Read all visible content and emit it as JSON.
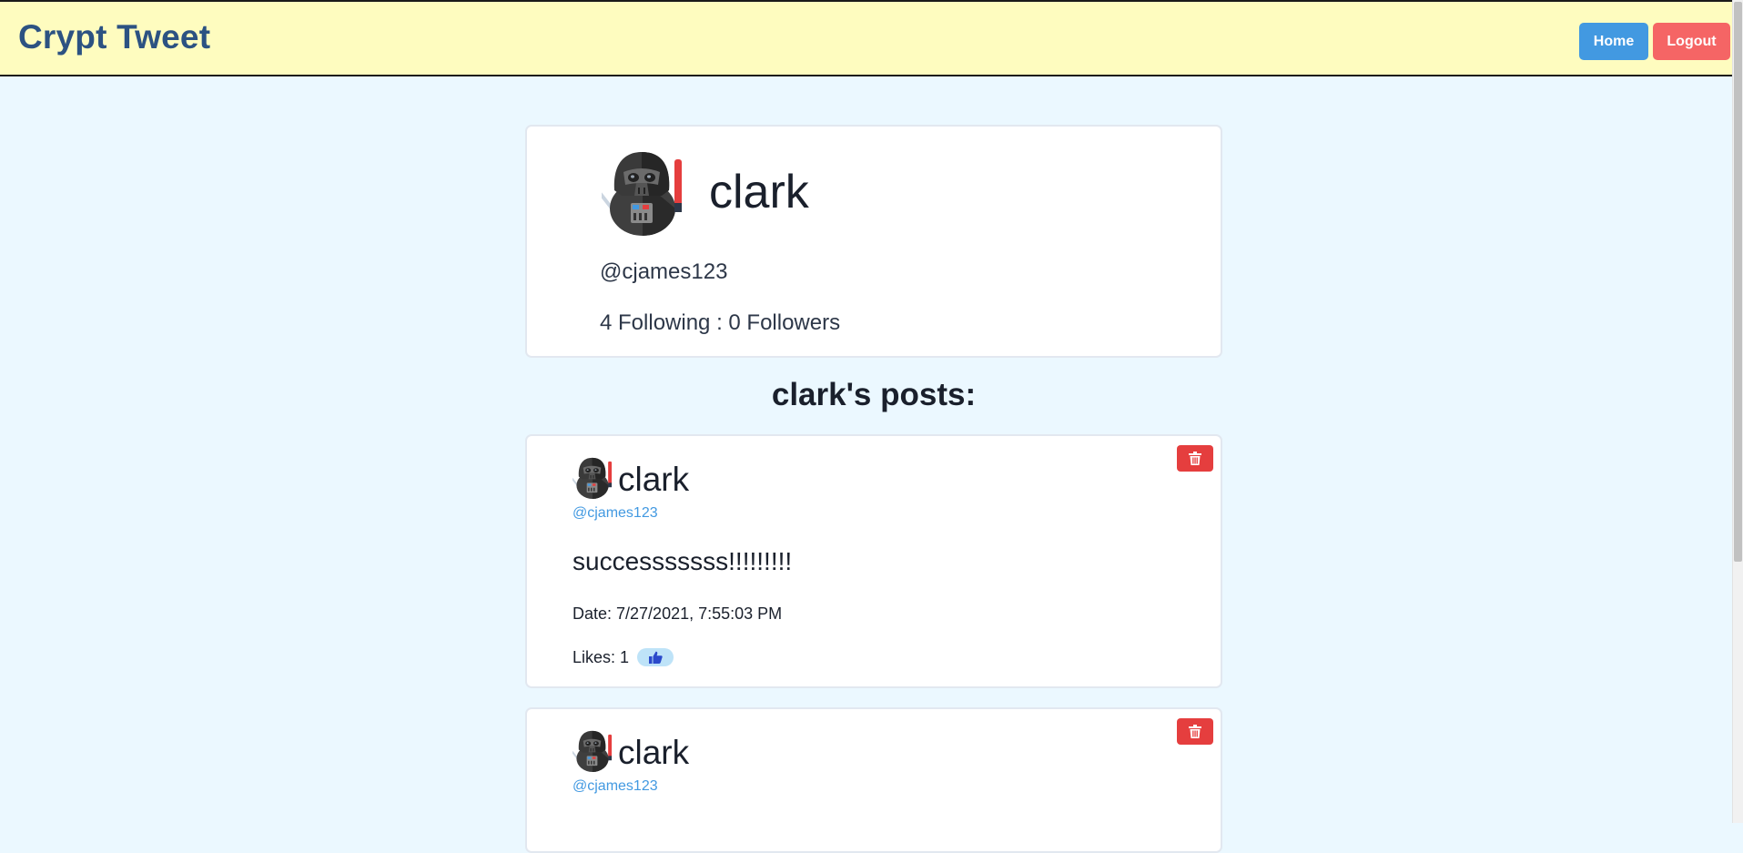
{
  "app": {
    "title": "Crypt Tweet"
  },
  "nav": {
    "home_label": "Home",
    "logout_label": "Logout"
  },
  "profile": {
    "name": "clark",
    "handle": "@cjames123",
    "stats": "4 Following : 0 Followers",
    "avatar_icon": "darth-vader-avatar-icon"
  },
  "posts_heading": "clark's posts:",
  "posts": [
    {
      "author": "clark",
      "handle": "@cjames123",
      "body": "successsssss!!!!!!!!!",
      "date": "Date: 7/27/2021, 7:55:03 PM",
      "likes": "Likes: 1",
      "delete_icon": "trash-icon",
      "like_icon": "thumbs-up-icon"
    },
    {
      "author": "clark",
      "handle": "@cjames123",
      "delete_icon": "trash-icon"
    }
  ],
  "colors": {
    "page_bg": "#ebf8ff",
    "navbar_bg": "#fefcbf",
    "brand": "#2c5282",
    "home_button": "#4299e1",
    "logout_button": "#f56565",
    "delete_button": "#e53e3e",
    "handle_link": "#4299e1",
    "like_pill": "#bee3f8"
  }
}
